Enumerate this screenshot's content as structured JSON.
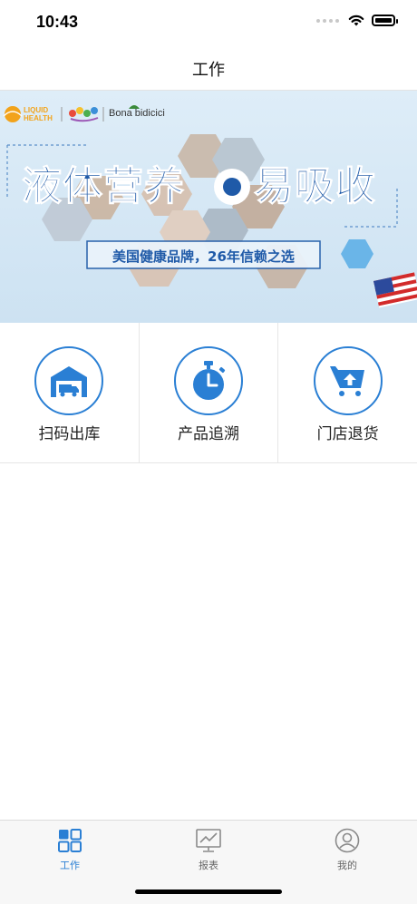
{
  "status_bar": {
    "time": "10:43"
  },
  "nav": {
    "title": "工作"
  },
  "banner": {
    "brand_1": "LIQUID HEALTH",
    "brand_2": "Bona bidicici",
    "headline_left": "液体营养",
    "headline_right": "易吸收",
    "tagline": "美国健康品牌，26年信赖之选"
  },
  "grid": [
    {
      "label": "扫码出库",
      "icon": "warehouse-truck-icon"
    },
    {
      "label": "产品追溯",
      "icon": "stopwatch-icon"
    },
    {
      "label": "门店退货",
      "icon": "return-cart-icon"
    }
  ],
  "tabs": [
    {
      "label": "工作",
      "icon": "grid-icon",
      "active": true
    },
    {
      "label": "报表",
      "icon": "chart-monitor-icon",
      "active": false
    },
    {
      "label": "我的",
      "icon": "user-icon",
      "active": false
    }
  ],
  "colors": {
    "accent": "#2a7fd4",
    "banner_bg": "#d5e7f4",
    "headline": "#1f5aa8"
  }
}
